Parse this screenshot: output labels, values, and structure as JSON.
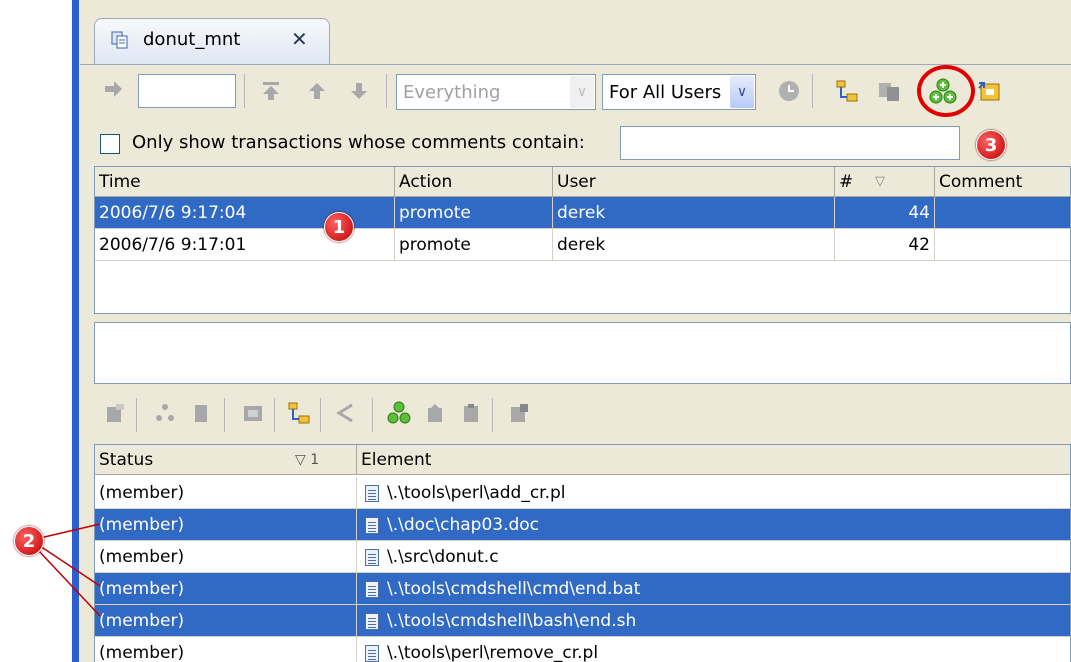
{
  "tab": {
    "title": "donut_mnt",
    "close": "✕"
  },
  "toolbar": {
    "go_field_value": "",
    "filter_select": "Everything",
    "users_select": "For All Users"
  },
  "filter": {
    "label": "Only show transactions whose comments contain:",
    "value": ""
  },
  "transactions": {
    "columns": [
      "Time",
      "Action",
      "User",
      "#",
      "Comment"
    ],
    "sort_indicator": "▽",
    "rows": [
      {
        "time": "2006/7/6 9:17:04",
        "action": "promote",
        "user": "derek",
        "num": "44",
        "comment": "",
        "selected": true
      },
      {
        "time": "2006/7/6 9:17:01",
        "action": "promote",
        "user": "derek",
        "num": "42",
        "comment": "",
        "selected": false
      }
    ]
  },
  "elements": {
    "columns": [
      "Status",
      "Element"
    ],
    "sort_indicator": "▽ 1",
    "rows": [
      {
        "status": "(member)",
        "element": "\\.\\tools\\perl\\add_cr.pl",
        "selected": false
      },
      {
        "status": "(member)",
        "element": "\\.\\doc\\chap03.doc",
        "selected": true
      },
      {
        "status": "(member)",
        "element": "\\.\\src\\donut.c",
        "selected": false
      },
      {
        "status": "(member)",
        "element": "\\.\\tools\\cmdshell\\cmd\\end.bat",
        "selected": true
      },
      {
        "status": "(member)",
        "element": "\\.\\tools\\cmdshell\\bash\\end.sh",
        "selected": true
      },
      {
        "status": "(member)",
        "element": "\\.\\tools\\perl\\remove_cr.pl",
        "selected": false
      }
    ]
  },
  "callouts": {
    "one": "1",
    "two": "2",
    "three": "3"
  },
  "colors": {
    "selection": "#316ac5",
    "callout": "#e00000",
    "frame": "#ece9d8"
  }
}
